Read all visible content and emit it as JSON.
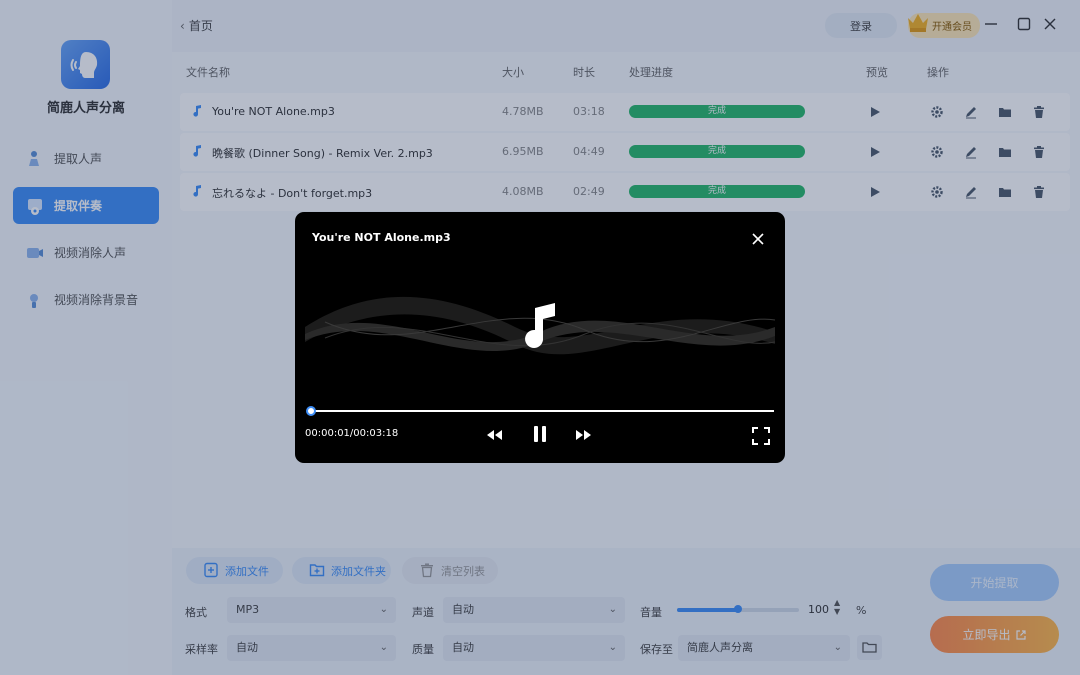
{
  "app": {
    "name": "简鹿人声分离"
  },
  "sidebar": {
    "items": [
      {
        "label": "提取人声",
        "icon": "person-voice-icon",
        "active": false
      },
      {
        "label": "提取伴奏",
        "icon": "accompaniment-icon",
        "active": true
      },
      {
        "label": "视频消除人声",
        "icon": "video-remove-voice-icon",
        "active": false
      },
      {
        "label": "视频消除背景音",
        "icon": "video-remove-bg-icon",
        "active": false
      }
    ]
  },
  "header": {
    "back_label": "首页",
    "login_label": "登录",
    "vip_label": "开通会员"
  },
  "table": {
    "columns": [
      "文件名称",
      "大小",
      "时长",
      "处理进度",
      "预览",
      "操作"
    ],
    "rows": [
      {
        "name": "You're NOT Alone.mp3",
        "size": "4.78MB",
        "duration": "03:18",
        "status": "完成"
      },
      {
        "name": "晩餐歌 (Dinner Song) - Remix Ver. 2.mp3",
        "size": "6.95MB",
        "duration": "04:49",
        "status": "完成"
      },
      {
        "name": "忘れるなよ - Don't forget.mp3",
        "size": "4.08MB",
        "duration": "02:49",
        "status": "完成"
      }
    ]
  },
  "toolbar": {
    "add_file": "添加文件",
    "add_folder": "添加文件夹",
    "clear_list": "清空列表"
  },
  "settings": {
    "format_label": "格式",
    "format_value": "MP3",
    "channel_label": "声道",
    "channel_value": "自动",
    "volume_label": "音量",
    "volume_value": "100",
    "volume_unit": "%",
    "samplerate_label": "采样率",
    "samplerate_value": "自动",
    "quality_label": "质量",
    "quality_value": "自动",
    "saveto_label": "保存至",
    "saveto_value": "简鹿人声分离"
  },
  "actions": {
    "start_label": "开始提取",
    "export_label": "立即导出"
  },
  "player": {
    "title": "You're NOT Alone.mp3",
    "time": "00:00:01/00:03:18",
    "progress": 0.005
  },
  "colors": {
    "accent": "#3e8ef7",
    "done_green": "#27b869",
    "export_orange": "#ff8a4c"
  }
}
